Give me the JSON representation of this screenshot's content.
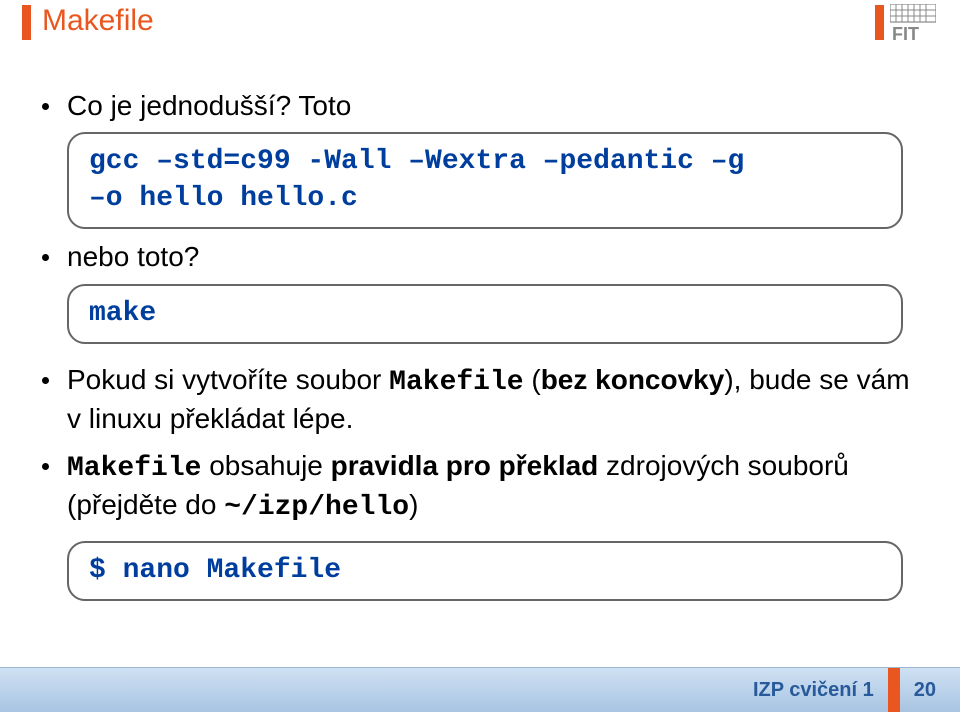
{
  "header": {
    "title": "Makefile"
  },
  "bullets": {
    "intro": "Co je jednodušší? Toto",
    "code1_line1": "gcc –std=c99 -Wall –Wextra –pedantic –g",
    "code1_line2": "–o hello hello.c",
    "nebo": "nebo toto?",
    "code2": "make",
    "point3_a": "Pokud si vytvoříte soubor ",
    "point3_code": "Makefile",
    "point3_b": " (",
    "point3_bold": "bez koncovky",
    "point3_c": "), bude se vám v linuxu překládat lépe.",
    "point4_code1": "Makefile",
    "point4_a": " obsahuje ",
    "point4_bold": "pravidla pro překlad",
    "point4_b": " zdrojových souborů (přejděte do ",
    "point4_code2": "~/izp/hello",
    "point4_c": ")",
    "code3": "$ nano Makefile"
  },
  "footer": {
    "course": "IZP cvičení 1",
    "page": "20"
  }
}
